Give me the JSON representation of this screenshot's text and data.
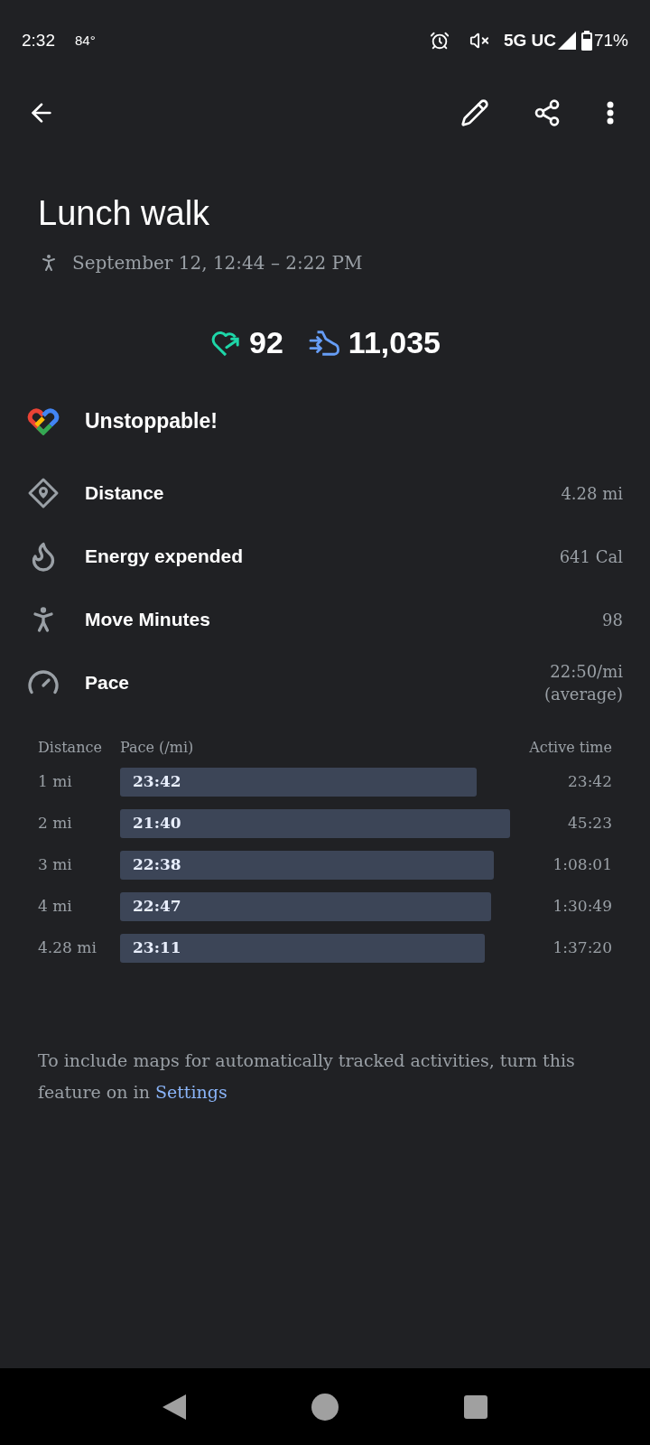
{
  "status_bar": {
    "time": "2:32",
    "weather": "84°",
    "network": "5G UC",
    "battery": "71%"
  },
  "title": "Lunch walk",
  "date": "September 12, 12:44 – 2:22 PM",
  "stats": [
    {
      "kind": "heart",
      "value": "92"
    },
    {
      "kind": "steps",
      "value": "11,035"
    }
  ],
  "achievement": "Unstoppable!",
  "metrics": [
    {
      "kind": "distance",
      "label": "Distance",
      "value": "4.28 mi"
    },
    {
      "kind": "energy",
      "label": "Energy expended",
      "value": "641 Cal"
    },
    {
      "kind": "move",
      "label": "Move Minutes",
      "value": "98"
    },
    {
      "kind": "pace",
      "label": "Pace",
      "value": "22:50/mi",
      "note": "(average)"
    }
  ],
  "splits": {
    "columns": [
      "Distance",
      "Pace (/mi)",
      "Active time"
    ],
    "rows": [
      {
        "distance": "1 mi",
        "pace": "23:42",
        "time": "23:42"
      },
      {
        "distance": "2 mi",
        "pace": "21:40",
        "time": "45:23"
      },
      {
        "distance": "3 mi",
        "pace": "22:38",
        "time": "1:08:01"
      },
      {
        "distance": "4 mi",
        "pace": "22:47",
        "time": "1:30:49"
      },
      {
        "distance": "4.28 mi",
        "pace": "23:11",
        "time": "1:37:20"
      }
    ]
  },
  "footer": {
    "text": "To include maps for automatically tracked activities, turn this feature on in",
    "link": "Settings"
  }
}
